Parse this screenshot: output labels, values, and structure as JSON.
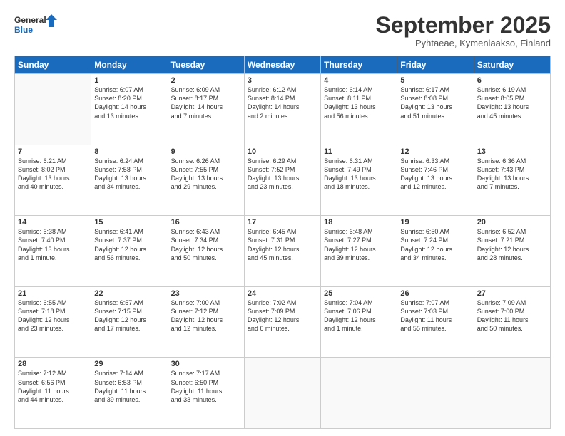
{
  "logo": {
    "line1": "General",
    "line2": "Blue"
  },
  "title": "September 2025",
  "location": "Pyhtaeae, Kymenlaakso, Finland",
  "days_header": [
    "Sunday",
    "Monday",
    "Tuesday",
    "Wednesday",
    "Thursday",
    "Friday",
    "Saturday"
  ],
  "weeks": [
    [
      {
        "day": "",
        "info": ""
      },
      {
        "day": "1",
        "info": "Sunrise: 6:07 AM\nSunset: 8:20 PM\nDaylight: 14 hours\nand 13 minutes."
      },
      {
        "day": "2",
        "info": "Sunrise: 6:09 AM\nSunset: 8:17 PM\nDaylight: 14 hours\nand 7 minutes."
      },
      {
        "day": "3",
        "info": "Sunrise: 6:12 AM\nSunset: 8:14 PM\nDaylight: 14 hours\nand 2 minutes."
      },
      {
        "day": "4",
        "info": "Sunrise: 6:14 AM\nSunset: 8:11 PM\nDaylight: 13 hours\nand 56 minutes."
      },
      {
        "day": "5",
        "info": "Sunrise: 6:17 AM\nSunset: 8:08 PM\nDaylight: 13 hours\nand 51 minutes."
      },
      {
        "day": "6",
        "info": "Sunrise: 6:19 AM\nSunset: 8:05 PM\nDaylight: 13 hours\nand 45 minutes."
      }
    ],
    [
      {
        "day": "7",
        "info": "Sunrise: 6:21 AM\nSunset: 8:02 PM\nDaylight: 13 hours\nand 40 minutes."
      },
      {
        "day": "8",
        "info": "Sunrise: 6:24 AM\nSunset: 7:58 PM\nDaylight: 13 hours\nand 34 minutes."
      },
      {
        "day": "9",
        "info": "Sunrise: 6:26 AM\nSunset: 7:55 PM\nDaylight: 13 hours\nand 29 minutes."
      },
      {
        "day": "10",
        "info": "Sunrise: 6:29 AM\nSunset: 7:52 PM\nDaylight: 13 hours\nand 23 minutes."
      },
      {
        "day": "11",
        "info": "Sunrise: 6:31 AM\nSunset: 7:49 PM\nDaylight: 13 hours\nand 18 minutes."
      },
      {
        "day": "12",
        "info": "Sunrise: 6:33 AM\nSunset: 7:46 PM\nDaylight: 13 hours\nand 12 minutes."
      },
      {
        "day": "13",
        "info": "Sunrise: 6:36 AM\nSunset: 7:43 PM\nDaylight: 13 hours\nand 7 minutes."
      }
    ],
    [
      {
        "day": "14",
        "info": "Sunrise: 6:38 AM\nSunset: 7:40 PM\nDaylight: 13 hours\nand 1 minute."
      },
      {
        "day": "15",
        "info": "Sunrise: 6:41 AM\nSunset: 7:37 PM\nDaylight: 12 hours\nand 56 minutes."
      },
      {
        "day": "16",
        "info": "Sunrise: 6:43 AM\nSunset: 7:34 PM\nDaylight: 12 hours\nand 50 minutes."
      },
      {
        "day": "17",
        "info": "Sunrise: 6:45 AM\nSunset: 7:31 PM\nDaylight: 12 hours\nand 45 minutes."
      },
      {
        "day": "18",
        "info": "Sunrise: 6:48 AM\nSunset: 7:27 PM\nDaylight: 12 hours\nand 39 minutes."
      },
      {
        "day": "19",
        "info": "Sunrise: 6:50 AM\nSunset: 7:24 PM\nDaylight: 12 hours\nand 34 minutes."
      },
      {
        "day": "20",
        "info": "Sunrise: 6:52 AM\nSunset: 7:21 PM\nDaylight: 12 hours\nand 28 minutes."
      }
    ],
    [
      {
        "day": "21",
        "info": "Sunrise: 6:55 AM\nSunset: 7:18 PM\nDaylight: 12 hours\nand 23 minutes."
      },
      {
        "day": "22",
        "info": "Sunrise: 6:57 AM\nSunset: 7:15 PM\nDaylight: 12 hours\nand 17 minutes."
      },
      {
        "day": "23",
        "info": "Sunrise: 7:00 AM\nSunset: 7:12 PM\nDaylight: 12 hours\nand 12 minutes."
      },
      {
        "day": "24",
        "info": "Sunrise: 7:02 AM\nSunset: 7:09 PM\nDaylight: 12 hours\nand 6 minutes."
      },
      {
        "day": "25",
        "info": "Sunrise: 7:04 AM\nSunset: 7:06 PM\nDaylight: 12 hours\nand 1 minute."
      },
      {
        "day": "26",
        "info": "Sunrise: 7:07 AM\nSunset: 7:03 PM\nDaylight: 11 hours\nand 55 minutes."
      },
      {
        "day": "27",
        "info": "Sunrise: 7:09 AM\nSunset: 7:00 PM\nDaylight: 11 hours\nand 50 minutes."
      }
    ],
    [
      {
        "day": "28",
        "info": "Sunrise: 7:12 AM\nSunset: 6:56 PM\nDaylight: 11 hours\nand 44 minutes."
      },
      {
        "day": "29",
        "info": "Sunrise: 7:14 AM\nSunset: 6:53 PM\nDaylight: 11 hours\nand 39 minutes."
      },
      {
        "day": "30",
        "info": "Sunrise: 7:17 AM\nSunset: 6:50 PM\nDaylight: 11 hours\nand 33 minutes."
      },
      {
        "day": "",
        "info": ""
      },
      {
        "day": "",
        "info": ""
      },
      {
        "day": "",
        "info": ""
      },
      {
        "day": "",
        "info": ""
      }
    ]
  ]
}
